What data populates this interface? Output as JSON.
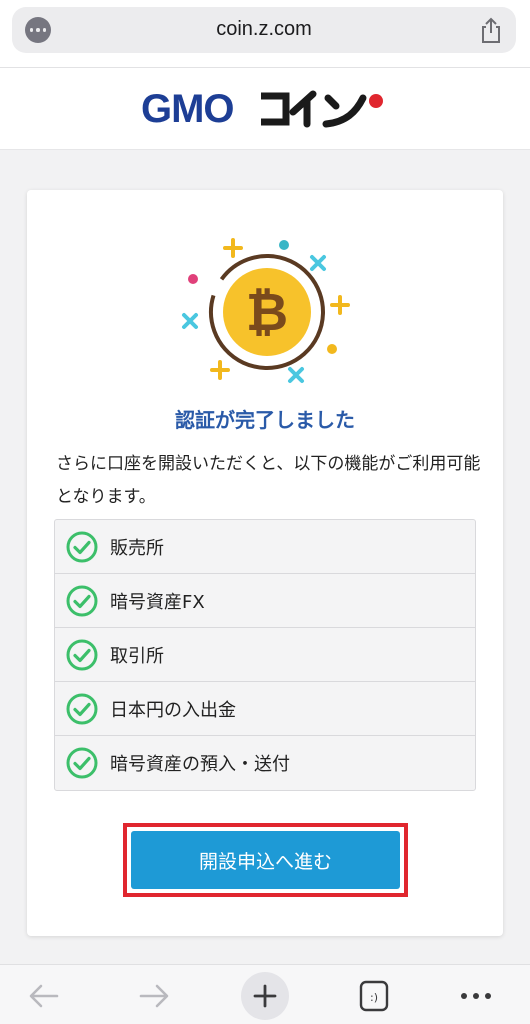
{
  "browser": {
    "url": "coin.z.com",
    "tabs_icon_label": ":)"
  },
  "brand": {
    "name": "GMOコイン",
    "color_primary": "#1d3e95",
    "color_dot": "#e0262e"
  },
  "card": {
    "title": "認証が完了しました",
    "description": "さらに口座を開設いただくと、以下の機能がご利用可能となります。",
    "features": [
      "販売所",
      "暗号資産FX",
      "取引所",
      "日本円の入出金",
      "暗号資産の預入・送付"
    ],
    "cta_label": "開設申込へ進む",
    "icon": "bitcoin-icon"
  },
  "colors": {
    "title": "#2a5aa8",
    "check": "#3cbf6a",
    "cta_background": "#1e9ad6",
    "cta_highlight_border": "#e0262e"
  }
}
